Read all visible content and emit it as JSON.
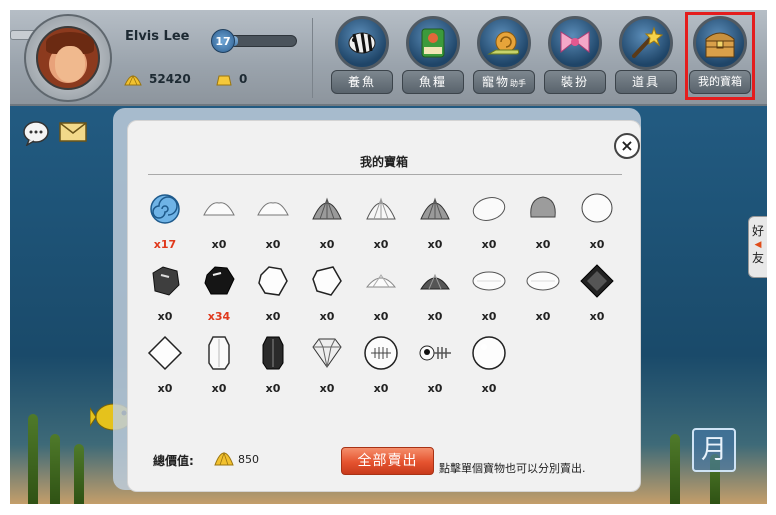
{
  "player": {
    "name": "Elvis Lee",
    "level": "17",
    "xp_fraction": 0.12,
    "coins": "52420",
    "gems": "0"
  },
  "menu": [
    {
      "label": "養魚",
      "icon": "fish-icon"
    },
    {
      "label": "魚糧",
      "icon": "fish-food-icon"
    },
    {
      "label": "寵物",
      "sublabel": "助手",
      "icon": "snail-icon"
    },
    {
      "label": "裝扮",
      "icon": "bow-icon"
    },
    {
      "label": "道具",
      "icon": "magic-wand-icon"
    },
    {
      "label": "我的寶箱",
      "icon": "treasure-chest-icon",
      "highlighted": true
    }
  ],
  "side": {
    "friend_tab_top": "好",
    "friend_tab_bottom": "友",
    "moon_label": "月"
  },
  "modal": {
    "title": "我的寶箱",
    "close": "×",
    "items": [
      {
        "icon": "blue-spiral-shell-icon",
        "count": "x17",
        "highlight": true
      },
      {
        "icon": "white-shell-icon",
        "count": "x0"
      },
      {
        "icon": "white-shell-icon",
        "count": "x0"
      },
      {
        "icon": "grey-scallop-icon",
        "count": "x0"
      },
      {
        "icon": "white-scallop-icon",
        "count": "x0"
      },
      {
        "icon": "grey-scallop-icon",
        "count": "x0"
      },
      {
        "icon": "white-pebble-icon",
        "count": "x0"
      },
      {
        "icon": "grey-pebble-icon",
        "count": "x0"
      },
      {
        "icon": "white-egg-icon",
        "count": "x0"
      },
      {
        "icon": "dark-stone-icon",
        "count": "x0"
      },
      {
        "icon": "black-gem-icon",
        "count": "x34",
        "highlight": true
      },
      {
        "icon": "white-stone-icon",
        "count": "x0"
      },
      {
        "icon": "white-crystal-icon",
        "count": "x0"
      },
      {
        "icon": "small-white-shell-icon",
        "count": "x0"
      },
      {
        "icon": "dark-scallop-icon",
        "count": "x0"
      },
      {
        "icon": "white-oval-icon",
        "count": "x0"
      },
      {
        "icon": "white-oval-icon",
        "count": "x0"
      },
      {
        "icon": "black-square-gem-icon",
        "count": "x0"
      },
      {
        "icon": "white-square-gem-icon",
        "count": "x0"
      },
      {
        "icon": "white-long-crystal-icon",
        "count": "x0"
      },
      {
        "icon": "black-long-crystal-icon",
        "count": "x0"
      },
      {
        "icon": "diamond-icon",
        "count": "x0"
      },
      {
        "icon": "fossil-fish-orb-icon",
        "count": "x0"
      },
      {
        "icon": "fish-skeleton-icon",
        "count": "x0"
      },
      {
        "icon": "white-pearl-icon",
        "count": "x0"
      }
    ],
    "total_label": "總價值:",
    "total_value": "850",
    "sell_all_label": "全部賣出",
    "sell_hint": "點擊單個寶物也可以分別賣出."
  },
  "colors": {
    "highlight_count": "#e0391c",
    "sell_button": "#e5532f",
    "menu_outline": "#e41d1d"
  }
}
